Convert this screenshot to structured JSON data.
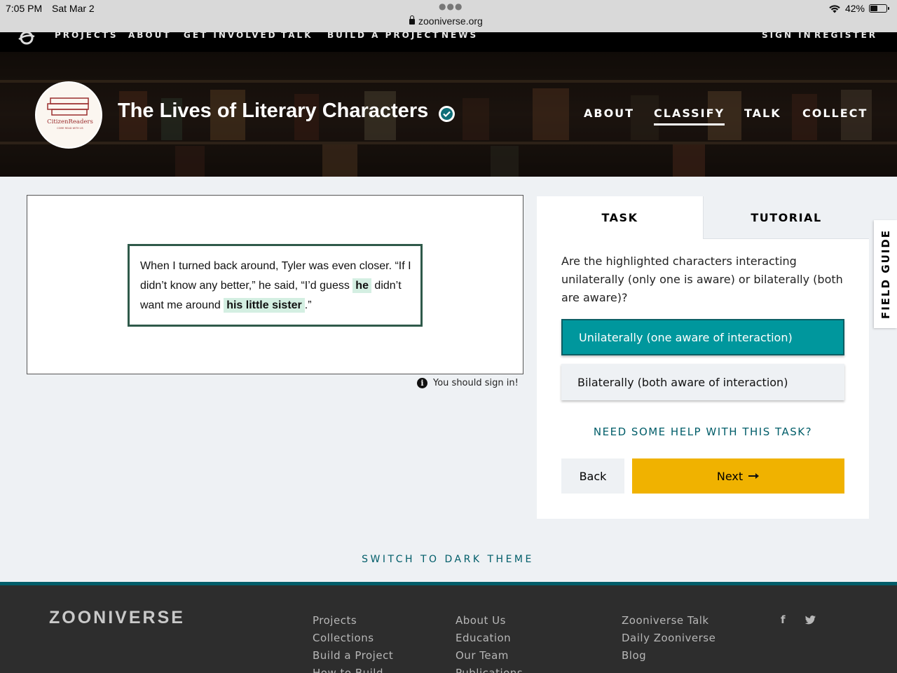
{
  "status_bar": {
    "time": "7:05 PM",
    "date": "Sat Mar 2",
    "url": "zooniverse.org",
    "battery": "42%",
    "battery_level": 0.42
  },
  "top_nav": {
    "items": [
      "PROJECTS",
      "ABOUT",
      "GET INVOLVED",
      "TALK",
      "BUILD A PROJECT",
      "NEWS"
    ],
    "sign_in": "SIGN IN",
    "register": "REGISTER"
  },
  "project": {
    "logo_text": "CitizenReaders",
    "logo_tagline": "COME READ WITH US",
    "title": "The Lives of Literary Characters",
    "nav": [
      "ABOUT",
      "CLASSIFY",
      "TALK",
      "COLLECT"
    ],
    "active_nav": "CLASSIFY"
  },
  "subject": {
    "text_1": "When I turned back around, Tyler was even closer. “If I didn’t know any better,” he said, “I’d guess",
    "highlight_1": "he",
    "text_2": "didn’t want me around",
    "highlight_2": "his little sister",
    "text_3": ".”",
    "sign_in_note": "You should sign in!"
  },
  "task": {
    "tab_task": "TASK",
    "tab_tutorial": "TUTORIAL",
    "question": "Are the highlighted characters interacting unilaterally (only one is aware) or bilaterally (both are aware)?",
    "answers": [
      "Unilaterally (one aware of interaction)",
      "Bilaterally (both aware of interaction)"
    ],
    "help": "NEED SOME HELP WITH THIS TASK?",
    "back": "Back",
    "next": "Next"
  },
  "field_guide": "FIELD GUIDE",
  "dark_theme": "SWITCH TO DARK THEME",
  "footer": {
    "logo": "ZOONIVERSE",
    "col1": [
      "Projects",
      "Collections",
      "Build a Project",
      "How to Build"
    ],
    "col2": [
      "About Us",
      "Education",
      "Our Team",
      "Publications"
    ],
    "col3": [
      "Zooniverse Talk",
      "Daily Zooniverse",
      "Blog"
    ],
    "social": [
      "facebook-icon",
      "twitter-icon"
    ]
  },
  "colors": {
    "accent_teal": "#00979d",
    "next_yellow": "#f0b200",
    "link_teal": "#005d69",
    "footer_bg": "#2d2d2d"
  }
}
